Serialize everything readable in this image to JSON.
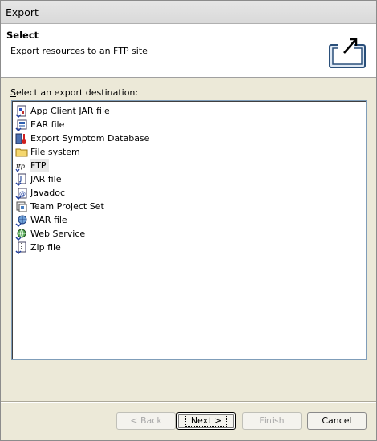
{
  "window": {
    "title": "Export"
  },
  "banner": {
    "heading": "Select",
    "description": "Export resources to an FTP site"
  },
  "list": {
    "label_mnemonic": "S",
    "label_rest": "elect an export destination:",
    "items": [
      {
        "label": "App Client JAR file",
        "icon": "app-client-jar-icon"
      },
      {
        "label": "EAR file",
        "icon": "ear-file-icon"
      },
      {
        "label": "Export Symptom Database",
        "icon": "symptom-database-icon"
      },
      {
        "label": "File system",
        "icon": "folder-icon"
      },
      {
        "label": "FTP",
        "icon": "ftp-icon",
        "selected": true
      },
      {
        "label": "JAR file",
        "icon": "jar-file-icon"
      },
      {
        "label": "Javadoc",
        "icon": "javadoc-icon"
      },
      {
        "label": "Team Project Set",
        "icon": "team-project-set-icon"
      },
      {
        "label": "WAR file",
        "icon": "war-file-icon"
      },
      {
        "label": "Web Service",
        "icon": "web-service-icon"
      },
      {
        "label": "Zip file",
        "icon": "zip-file-icon"
      }
    ]
  },
  "buttons": {
    "back": "< Back",
    "next": "Next >",
    "finish": "Finish",
    "cancel": "Cancel"
  },
  "colors": {
    "selection": "#e8e8e8",
    "list_border": "#7f9db9",
    "dialog_bg": "#ece9d8"
  }
}
